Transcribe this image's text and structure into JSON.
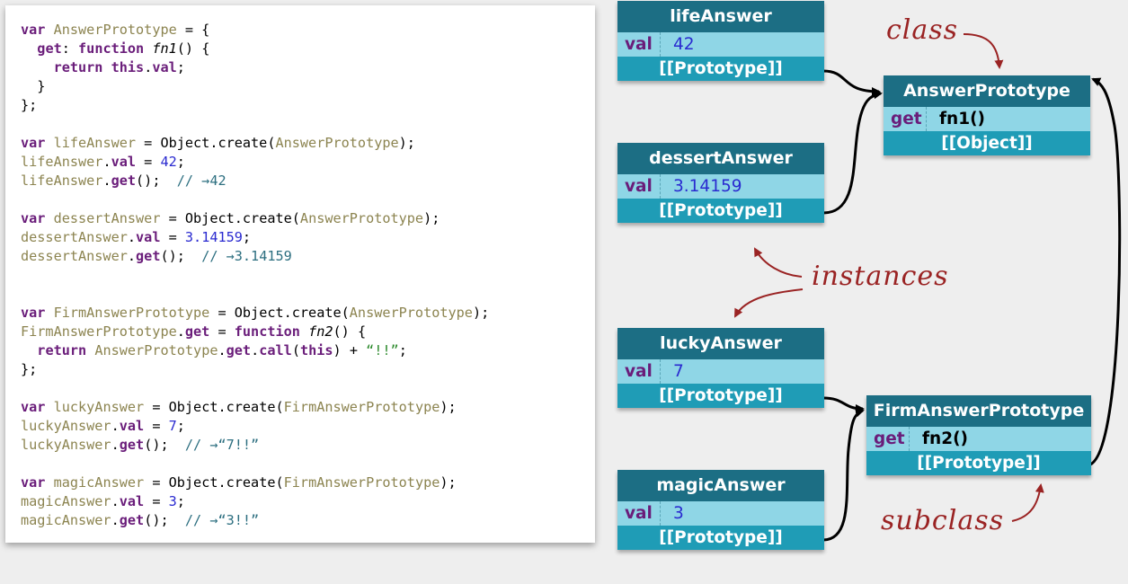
{
  "code_lines": [
    [
      [
        "kw",
        "var"
      ],
      [
        "pl",
        " "
      ],
      [
        "va",
        "AnswerPrototype"
      ],
      [
        "pl",
        " = {"
      ]
    ],
    [
      [
        "pl",
        "  "
      ],
      [
        "pr",
        "get"
      ],
      [
        "pl",
        ": "
      ],
      [
        "kw",
        "function"
      ],
      [
        "pl",
        " "
      ],
      [
        "fn",
        "fn1"
      ],
      [
        "pl",
        "() {"
      ]
    ],
    [
      [
        "pl",
        "    "
      ],
      [
        "kw",
        "return"
      ],
      [
        "pl",
        " "
      ],
      [
        "kw",
        "this"
      ],
      [
        "pl",
        "."
      ],
      [
        "pr",
        "val"
      ],
      [
        "pl",
        ";"
      ]
    ],
    [
      [
        "pl",
        "  }"
      ]
    ],
    [
      [
        "pl",
        "};"
      ]
    ],
    [
      [
        "pl",
        ""
      ]
    ],
    [
      [
        "kw",
        "var"
      ],
      [
        "pl",
        " "
      ],
      [
        "va",
        "lifeAnswer"
      ],
      [
        "pl",
        " = Object.create("
      ],
      [
        "va",
        "AnswerPrototype"
      ],
      [
        "pl",
        ");"
      ]
    ],
    [
      [
        "va",
        "lifeAnswer"
      ],
      [
        "pl",
        "."
      ],
      [
        "pr",
        "val"
      ],
      [
        "pl",
        " = "
      ],
      [
        "nu",
        "42"
      ],
      [
        "pl",
        ";"
      ]
    ],
    [
      [
        "va",
        "lifeAnswer"
      ],
      [
        "pl",
        "."
      ],
      [
        "pr",
        "get"
      ],
      [
        "pl",
        "();  "
      ],
      [
        "cm",
        "// →42"
      ]
    ],
    [
      [
        "pl",
        ""
      ]
    ],
    [
      [
        "kw",
        "var"
      ],
      [
        "pl",
        " "
      ],
      [
        "va",
        "dessertAnswer"
      ],
      [
        "pl",
        " = Object.create("
      ],
      [
        "va",
        "AnswerPrototype"
      ],
      [
        "pl",
        ");"
      ]
    ],
    [
      [
        "va",
        "dessertAnswer"
      ],
      [
        "pl",
        "."
      ],
      [
        "pr",
        "val"
      ],
      [
        "pl",
        " = "
      ],
      [
        "nu",
        "3.14159"
      ],
      [
        "pl",
        ";"
      ]
    ],
    [
      [
        "va",
        "dessertAnswer"
      ],
      [
        "pl",
        "."
      ],
      [
        "pr",
        "get"
      ],
      [
        "pl",
        "();  "
      ],
      [
        "cm",
        "// →3.14159"
      ]
    ],
    [
      [
        "pl",
        ""
      ]
    ],
    [
      [
        "pl",
        ""
      ]
    ],
    [
      [
        "kw",
        "var"
      ],
      [
        "pl",
        " "
      ],
      [
        "va",
        "FirmAnswerPrototype"
      ],
      [
        "pl",
        " = Object.create("
      ],
      [
        "va",
        "AnswerPrototype"
      ],
      [
        "pl",
        ");"
      ]
    ],
    [
      [
        "va",
        "FirmAnswerPrototype"
      ],
      [
        "pl",
        "."
      ],
      [
        "pr",
        "get"
      ],
      [
        "pl",
        " = "
      ],
      [
        "kw",
        "function"
      ],
      [
        "pl",
        " "
      ],
      [
        "fn",
        "fn2"
      ],
      [
        "pl",
        "() {"
      ]
    ],
    [
      [
        "pl",
        "  "
      ],
      [
        "kw",
        "return"
      ],
      [
        "pl",
        " "
      ],
      [
        "va",
        "AnswerPrototype"
      ],
      [
        "pl",
        "."
      ],
      [
        "pr",
        "get"
      ],
      [
        "pl",
        "."
      ],
      [
        "pr",
        "call"
      ],
      [
        "pl",
        "("
      ],
      [
        "kw",
        "this"
      ],
      [
        "pl",
        ") + "
      ],
      [
        "st",
        "“!!”"
      ],
      [
        "pl",
        ";"
      ]
    ],
    [
      [
        "pl",
        "};"
      ]
    ],
    [
      [
        "pl",
        ""
      ]
    ],
    [
      [
        "kw",
        "var"
      ],
      [
        "pl",
        " "
      ],
      [
        "va",
        "luckyAnswer"
      ],
      [
        "pl",
        " = Object.create("
      ],
      [
        "va",
        "FirmAnswerPrototype"
      ],
      [
        "pl",
        ");"
      ]
    ],
    [
      [
        "va",
        "luckyAnswer"
      ],
      [
        "pl",
        "."
      ],
      [
        "pr",
        "val"
      ],
      [
        "pl",
        " = "
      ],
      [
        "nu",
        "7"
      ],
      [
        "pl",
        ";"
      ]
    ],
    [
      [
        "va",
        "luckyAnswer"
      ],
      [
        "pl",
        "."
      ],
      [
        "pr",
        "get"
      ],
      [
        "pl",
        "();  "
      ],
      [
        "cm",
        "// →“7!!”"
      ]
    ],
    [
      [
        "pl",
        ""
      ]
    ],
    [
      [
        "kw",
        "var"
      ],
      [
        "pl",
        " "
      ],
      [
        "va",
        "magicAnswer"
      ],
      [
        "pl",
        " = Object.create("
      ],
      [
        "va",
        "FirmAnswerPrototype"
      ],
      [
        "pl",
        ");"
      ]
    ],
    [
      [
        "va",
        "magicAnswer"
      ],
      [
        "pl",
        "."
      ],
      [
        "pr",
        "val"
      ],
      [
        "pl",
        " = "
      ],
      [
        "nu",
        "3"
      ],
      [
        "pl",
        ";"
      ]
    ],
    [
      [
        "va",
        "magicAnswer"
      ],
      [
        "pl",
        "."
      ],
      [
        "pr",
        "get"
      ],
      [
        "pl",
        "();  "
      ],
      [
        "cm",
        "// →“3!!”"
      ]
    ]
  ],
  "objects": {
    "life": {
      "title": "lifeAnswer",
      "key": "val",
      "value": "42",
      "proto": "[[Prototype]]"
    },
    "dessert": {
      "title": "dessertAnswer",
      "key": "val",
      "value": "3.14159",
      "proto": "[[Prototype]]"
    },
    "lucky": {
      "title": "luckyAnswer",
      "key": "val",
      "value": "7",
      "proto": "[[Prototype]]"
    },
    "magic": {
      "title": "magicAnswer",
      "key": "val",
      "value": "3",
      "proto": "[[Prototype]]"
    },
    "answer_proto": {
      "title": "AnswerPrototype",
      "key": "get",
      "value": "fn1()",
      "proto": "[[Object]]"
    },
    "firm_proto": {
      "title": "FirmAnswerPrototype",
      "key": "get",
      "value": "fn2()",
      "proto": "[[Prototype]]"
    }
  },
  "annotations": {
    "class": "class",
    "instances": "instances",
    "subclass": "subclass"
  },
  "colors": {
    "box_title": "#1c6e84",
    "box_light": "#8fd6e6",
    "box_dark": "#1f9cb6",
    "handwriting": "#9a2323",
    "keyword": "#6a1d7a",
    "variable": "#8c8450",
    "number": "#2a2ad0",
    "comment": "#2d6f80"
  }
}
